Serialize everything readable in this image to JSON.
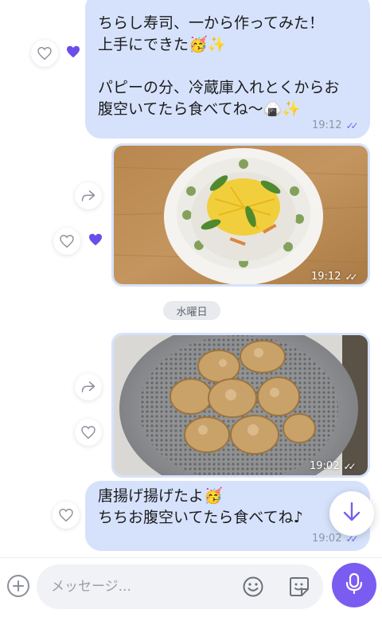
{
  "messages": [
    {
      "text": "ちらし寿司、一から作ってみた！\n上手にできた🥳✨\n\nパピーの分、冷蔵庫入れとくからお\n腹空いてたら食べてね〜🍙✨",
      "time": "19:12"
    },
    {
      "time": "19:12"
    },
    {
      "time": "19:02"
    },
    {
      "text": "唐揚げ揚げたよ🥳\nちちお腹空いてたら食べてね♪",
      "time": "19:02"
    }
  ],
  "day_separator": "水曜日",
  "composer": {
    "placeholder": "メッセージ..."
  },
  "icons": {
    "heart": "heart-icon",
    "heart_filled": "heart-filled-icon",
    "forward": "forward-icon",
    "read_receipt": "double-check-icon",
    "scroll": "arrow-down-icon",
    "plus": "plus-icon",
    "emoji": "smiley-icon",
    "sticker": "sticker-icon",
    "mic": "microphone-icon"
  },
  "colors": {
    "bubble": "#d6e2fb",
    "accent": "#7b5cf0",
    "check": "#6a6ef0"
  }
}
